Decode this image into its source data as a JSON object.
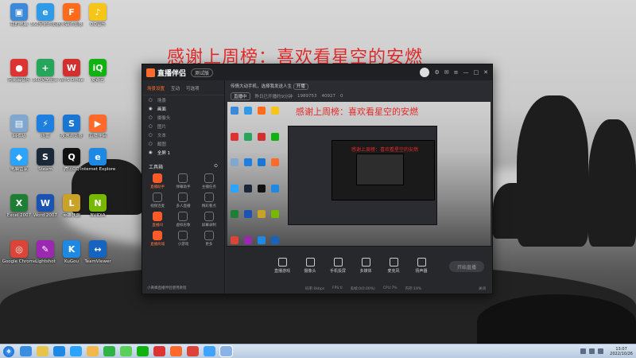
{
  "overlay_banner": "感谢上周榜：喜欢看星空的安燃",
  "desktop_icons": [
    {
      "label": "我的电脑",
      "color": "#3b8ad9",
      "glyph": "▣"
    },
    {
      "label": "360安全浏览器",
      "color": "#2f9ae8",
      "glyph": "e"
    },
    {
      "label": "火狐浏览器",
      "color": "#ff6b1a",
      "glyph": "F"
    },
    {
      "label": "QQ音乐",
      "color": "#f5c518",
      "glyph": "♪"
    },
    {
      "label": "网易云音乐",
      "color": "#d33",
      "glyph": "●"
    },
    {
      "label": "360安全卫士",
      "color": "#26a65b",
      "glyph": "+"
    },
    {
      "label": "WPS Office",
      "color": "#d32f2f",
      "glyph": "W"
    },
    {
      "label": "爱奇艺",
      "color": "#0fb20f",
      "glyph": "iQ"
    },
    {
      "label": "回收站",
      "color": "#7fa7cf",
      "glyph": "▤"
    },
    {
      "label": "迅雷",
      "color": "#1e7fe0",
      "glyph": "⚡"
    },
    {
      "label": "搜狗浏览器",
      "color": "#1976d2",
      "glyph": "S"
    },
    {
      "label": "直播伴侣",
      "color": "#ff6a2a",
      "glyph": "▶"
    },
    {
      "label": "电脑管家",
      "color": "#2aa4ff",
      "glyph": "◆"
    },
    {
      "label": "Steam",
      "color": "#1b2838",
      "glyph": "S"
    },
    {
      "label": "腾讯QQ",
      "color": "#111",
      "glyph": "Q"
    },
    {
      "label": "Internet Explorer",
      "color": "#1e88e5",
      "glyph": "e"
    },
    {
      "label": "Excel 2007",
      "color": "#1e7e34",
      "glyph": "X"
    },
    {
      "label": "Word 2007",
      "color": "#1a53b3",
      "glyph": "W"
    },
    {
      "label": "英雄联盟",
      "color": "#c9a227",
      "glyph": "L"
    },
    {
      "label": "NVIDIA",
      "color": "#76b900",
      "glyph": "N"
    },
    {
      "label": "Google Chrome",
      "color": "#db4437",
      "glyph": "◎"
    },
    {
      "label": "Lightshot",
      "color": "#9c27b0",
      "glyph": "✎"
    },
    {
      "label": "KuGou",
      "color": "#1e88e5",
      "glyph": "K"
    },
    {
      "label": "TeamViewer",
      "color": "#1565c0",
      "glyph": "↔"
    }
  ],
  "app": {
    "name": "直播伴侣",
    "version": "测试版",
    "left_tabs": [
      "场景设置",
      "互动",
      "可选项"
    ],
    "scenes": [
      {
        "label": "场景",
        "active": false
      },
      {
        "label": "画面",
        "active": true
      },
      {
        "label": "摄像头",
        "active": false
      },
      {
        "label": "图片",
        "active": false
      },
      {
        "label": "文本",
        "active": false
      },
      {
        "label": "截图",
        "active": false
      },
      {
        "label": "全屏 1",
        "active": true
      }
    ],
    "tools_title": "工具箱",
    "tools": [
      {
        "label": "直播助手",
        "hot": true
      },
      {
        "label": "弹幕助手",
        "hot": false
      },
      {
        "label": "主播任务",
        "hot": false
      },
      {
        "label": "视频连麦",
        "hot": false
      },
      {
        "label": "多人直播",
        "hot": false
      },
      {
        "label": "精彩看点",
        "hot": false
      },
      {
        "label": "直播间",
        "hot": true
      },
      {
        "label": "虚拟形象",
        "hot": false
      },
      {
        "label": "屏幕录制",
        "hot": false
      },
      {
        "label": "直播商城",
        "hot": true
      },
      {
        "label": "小游戏",
        "hot": false
      },
      {
        "label": "更多",
        "hot": false
      }
    ],
    "left_footer": "小黄蜂直播伴侣使用教程",
    "info_title": "传情大动手机，选择我发送人生",
    "info_tag": "开播",
    "info_row": [
      "直播中",
      "昨日已开播约9分钟",
      "1989753",
      "40927",
      "0"
    ],
    "controls": [
      "直播游戏",
      "摄像头",
      "手机投屏",
      "多媒体",
      "麦克风",
      "扬声器"
    ],
    "start_button": "开始直播",
    "status": [
      "码率:0kbps",
      "FPS:0",
      "丢帧:0(0.00%)",
      "CPU:7%",
      "内存:19%"
    ],
    "status_right": "关闭"
  },
  "taskbar": {
    "clock_time": "13:07",
    "clock_date": "2022/10/26"
  }
}
